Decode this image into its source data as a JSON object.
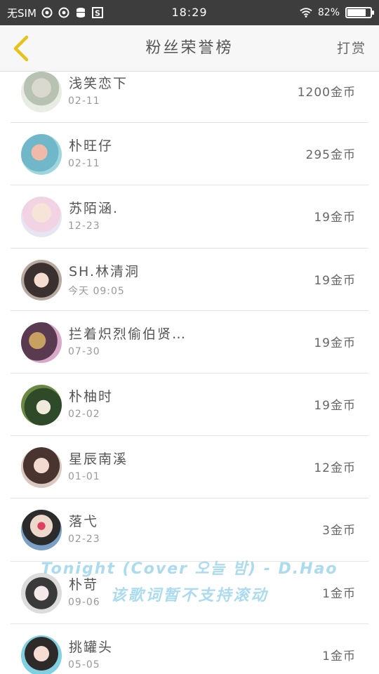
{
  "status_bar": {
    "carrier": "无SIM",
    "time": "18:29",
    "battery_percent": "82%",
    "battery_level": 0.82,
    "icons": [
      "weibo-icon",
      "weibo-icon",
      "database-icon",
      "s-app-icon",
      "wifi-icon",
      "battery-icon"
    ]
  },
  "header": {
    "title": "粉丝荣誉榜",
    "action_label": "打赏",
    "back_icon": "chevron-left-icon",
    "accent_color": "#e6c21a"
  },
  "fans": [
    {
      "name": "浅笑恋下",
      "date": "02-11",
      "coins": "1200金币"
    },
    {
      "name": "朴旺仔",
      "date": "02-11",
      "coins": "295金币"
    },
    {
      "name": "苏陌涵.",
      "date": "12-23",
      "coins": "19金币"
    },
    {
      "name": "SH.林清洞",
      "date": "今天 09:05",
      "coins": "19金币"
    },
    {
      "name": "拦着炽烈偷伯贤…",
      "date": "07-30",
      "coins": "19金币"
    },
    {
      "name": "朴柚时",
      "date": "02-02",
      "coins": "19金币"
    },
    {
      "name": "星辰南溪",
      "date": "01-01",
      "coins": "12金币"
    },
    {
      "name": "落弋",
      "date": "02-23",
      "coins": "3金币"
    },
    {
      "name": "朴苛",
      "date": "09-06",
      "coins": "1金币"
    },
    {
      "name": "挑罐头",
      "date": "05-05",
      "coins": "1金币"
    }
  ],
  "music_overlay": {
    "title": "Tonight (Cover 오늘 밤) - D.Hao",
    "subtitle": "该歌词暂不支持滚动"
  }
}
